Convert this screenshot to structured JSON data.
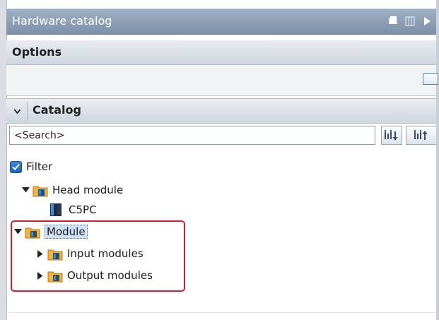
{
  "header": {
    "title": "Hardware catalog"
  },
  "options": {
    "label": "Options"
  },
  "catalog": {
    "label": "Catalog",
    "search": {
      "value": "<Search>"
    },
    "filter": {
      "label": "Filter",
      "checked": true
    },
    "tree": {
      "head_module": {
        "label": "Head module"
      },
      "c5pc": {
        "label": "C5PC"
      },
      "module": {
        "label": "Module"
      },
      "input_modules": {
        "label": "Input modules"
      },
      "output_modules": {
        "label": "Output modules"
      }
    }
  },
  "icons": {
    "pin": "pin-icon",
    "columns": "columns-icon",
    "collapse": "collapse-arrow-icon",
    "search_down": "search-down-icon",
    "search_up": "search-up-icon",
    "folder": "folder-icon",
    "module": "module-icon"
  },
  "colors": {
    "titlebar": "#8a9cb3",
    "selection": "#cfe0f7",
    "highlight_border": "#d0202f",
    "checkbox": "#2a74c6"
  }
}
